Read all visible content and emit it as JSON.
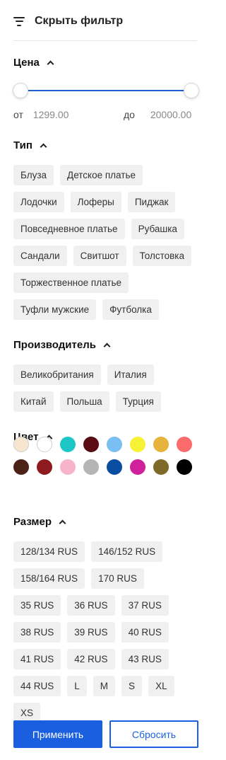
{
  "header": {
    "title": "Скрыть фильтр",
    "icon": "filter-lines-icon"
  },
  "price": {
    "title": "Цена",
    "from_label": "от",
    "from_value": "1299.00",
    "to_label": "до",
    "to_value": "20000.00",
    "slider_range": [
      0,
      1
    ]
  },
  "type": {
    "title": "Тип",
    "items": [
      "Блуза",
      "Детское платье",
      "Лодочки",
      "Лоферы",
      "Пиджак",
      "Повседневное платье",
      "Рубашка",
      "Сандали",
      "Свитшот",
      "Толстовка",
      "Торжественное платье",
      "Туфли мужские",
      "Футболка"
    ]
  },
  "manufacturer": {
    "title": "Производитель",
    "items": [
      "Великобритания",
      "Италия",
      "Китай",
      "Польша",
      "Турция"
    ]
  },
  "color": {
    "title": "Цвет",
    "swatches": [
      "#f6e6cf",
      "#ffffff",
      "#1fc6c6",
      "#5a0b14",
      "#79bff1",
      "#f8f236",
      "#e6b43d",
      "#fb6b6b",
      "#4a2316",
      "#8e1b1f",
      "#f7b3cb",
      "#b5b5b5",
      "#0a4ea2",
      "#d0219c",
      "#7e6a28",
      "#000000"
    ]
  },
  "size": {
    "title": "Размер",
    "items": [
      "128/134 RUS",
      "146/152 RUS",
      "158/164 RUS",
      "170 RUS",
      "35 RUS",
      "36 RUS",
      "37 RUS",
      "38 RUS",
      "39 RUS",
      "40 RUS",
      "41 RUS",
      "42 RUS",
      "43 RUS",
      "44 RUS",
      "L",
      "M",
      "S",
      "XL",
      "XS"
    ]
  },
  "buttons": {
    "apply": "Применить",
    "reset": "Сбросить"
  }
}
